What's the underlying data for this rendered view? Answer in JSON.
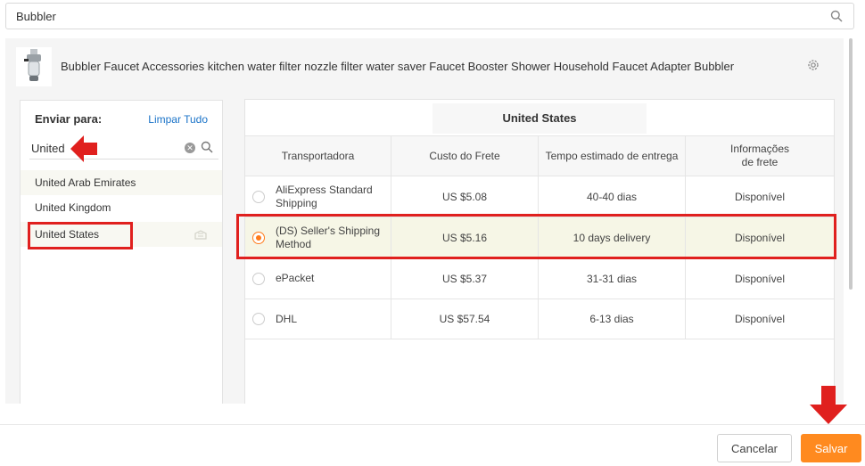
{
  "search": {
    "value": "Bubbler"
  },
  "product": {
    "title": "Bubbler Faucet Accessories kitchen water filter nozzle filter water saver Faucet Booster Shower Household Faucet Adapter Bubbler"
  },
  "destination": {
    "header": "Enviar para:",
    "clear_label": "Limpar Tudo",
    "filter_value": "United",
    "countries": [
      "United Arab Emirates",
      "United Kingdom",
      "United States"
    ]
  },
  "shipping": {
    "country": "United States",
    "columns": [
      "Transportadora",
      "Custo do Frete",
      "Tempo estimado de entrega",
      "Informações de frete"
    ],
    "rows": [
      {
        "carrier": "AliExpress Standard Shipping",
        "cost": "US $5.08",
        "time": "40-40 dias",
        "info": "Disponível",
        "selected": false
      },
      {
        "carrier": "(DS) Seller's Shipping Method",
        "cost": "US $5.16",
        "time": "10 days delivery",
        "info": "Disponível",
        "selected": true
      },
      {
        "carrier": "ePacket",
        "cost": "US $5.37",
        "time": "31-31 dias",
        "info": "Disponível",
        "selected": false
      },
      {
        "carrier": "DHL",
        "cost": "US $57.54",
        "time": "6-13 dias",
        "info": "Disponível",
        "selected": false
      }
    ]
  },
  "footer": {
    "cancel_label": "Cancelar",
    "save_label": "Salvar"
  },
  "colors": {
    "accent": "#ff8a1f",
    "link": "#1a73c8",
    "annotation": "#e0201e",
    "selected_row": "#f6f6e6"
  }
}
